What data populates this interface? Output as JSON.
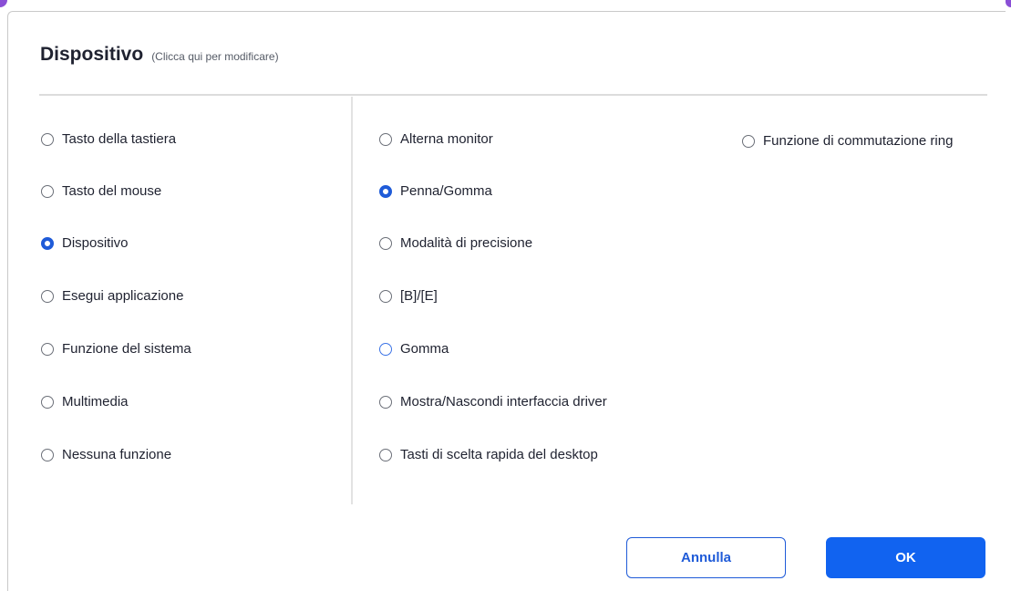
{
  "dialog": {
    "title": "Dispositivo",
    "title_hint": "(Clicca qui per modificare)"
  },
  "categories": [
    {
      "label": "Tasto della tastiera",
      "checked": false
    },
    {
      "label": "Tasto del mouse",
      "checked": false
    },
    {
      "label": "Dispositivo",
      "checked": true
    },
    {
      "label": "Esegui applicazione",
      "checked": false
    },
    {
      "label": "Funzione del sistema",
      "checked": false
    },
    {
      "label": "Multimedia",
      "checked": false
    },
    {
      "label": "Nessuna funzione",
      "checked": false
    }
  ],
  "device_options": [
    {
      "label": "Alterna monitor",
      "checked": false
    },
    {
      "label": "Penna/Gomma",
      "checked": true
    },
    {
      "label": "Modalità di precisione",
      "checked": false
    },
    {
      "label": "[B]/[E]",
      "checked": false
    },
    {
      "label": "Gomma",
      "checked": false,
      "hover": true
    },
    {
      "label": "Mostra/Nascondi interfaccia driver",
      "checked": false
    },
    {
      "label": "Tasti di scelta rapida del desktop",
      "checked": false
    }
  ],
  "extra_option": {
    "label": "Funzione di commutazione ring",
    "checked": false
  },
  "buttons": {
    "cancel_label": "Annulla",
    "ok_label": "OK"
  },
  "colors": {
    "accent": "#1163f0",
    "radio_checked": "#1f5bd8",
    "corner_accent": "#8a4fd6"
  }
}
